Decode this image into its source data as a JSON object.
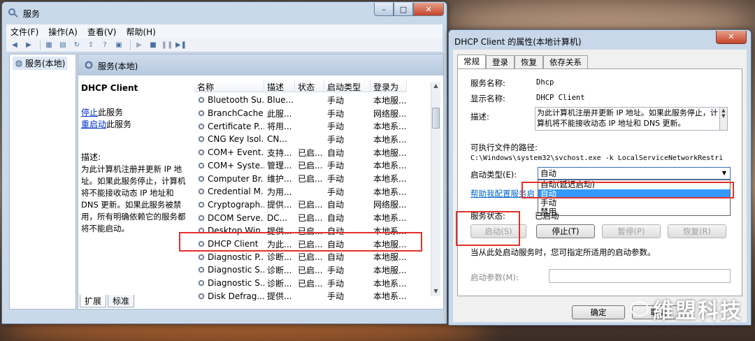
{
  "main_window": {
    "title": "服务",
    "caption": {
      "min": "–",
      "max": "□",
      "close": "✕"
    },
    "menu": [
      "文件(F)",
      "操作(A)",
      "查看(V)",
      "帮助(H)"
    ],
    "tree_root": "服务(本地)",
    "pane_title": "服务(本地)",
    "selected_service": "DHCP Client",
    "link_stop": "停止",
    "link_stop_suffix": "此服务",
    "link_restart": "重启动",
    "link_restart_suffix": "此服务",
    "desc_label": "描述:",
    "description": "为此计算机注册并更新 IP 地址。如果此服务停止，计算机将不能接收动态 IP 地址和 DNS 更新。如果此服务被禁用，所有明确依赖它的服务都将不能启动。",
    "columns": [
      "名称",
      "描述",
      "状态",
      "启动类型",
      "登录为"
    ],
    "rows": [
      [
        "Bluetooth Su...",
        "Blue...",
        "",
        "手动",
        "本地服..."
      ],
      [
        "BranchCache",
        "此服...",
        "",
        "手动",
        "网络服..."
      ],
      [
        "Certificate P...",
        "将用...",
        "",
        "手动",
        "本地系..."
      ],
      [
        "CNG Key Isol...",
        "CN...",
        "",
        "手动",
        "本地系..."
      ],
      [
        "COM+ Event...",
        "支持...",
        "已启...",
        "自动",
        "本地服..."
      ],
      [
        "COM+ Syste...",
        "管理...",
        "已启...",
        "手动",
        "本地系..."
      ],
      [
        "Computer Br...",
        "维护...",
        "已启...",
        "手动",
        "本地系..."
      ],
      [
        "Credential M...",
        "为用...",
        "",
        "手动",
        "本地系..."
      ],
      [
        "Cryptograph...",
        "提供...",
        "已启...",
        "自动",
        "网络服..."
      ],
      [
        "DCOM Serve...",
        "DC...",
        "已启...",
        "自动",
        "本地系..."
      ],
      [
        "Desktop Win...",
        "提供...",
        "已启...",
        "自动",
        "本地系..."
      ],
      [
        "DHCP Client",
        "为此...",
        "已启...",
        "自动",
        "本地服..."
      ],
      [
        "Diagnostic P...",
        "诊断...",
        "已启...",
        "自动",
        "本地服..."
      ],
      [
        "Diagnostic S...",
        "诊断...",
        "已启...",
        "手动",
        "本地服..."
      ],
      [
        "Diagnostic S...",
        "诊断...",
        "已启...",
        "手动",
        "本地系..."
      ],
      [
        "Disk Defrag...",
        "提供...",
        "",
        "手动",
        "本地系..."
      ]
    ],
    "bottom_tabs": [
      "扩展",
      "标准"
    ]
  },
  "dialog": {
    "title": "DHCP Client 的属性(本地计算机)",
    "close": "✕",
    "tabs": [
      "常规",
      "登录",
      "恢复",
      "依存关系"
    ],
    "service_name_label": "服务名称:",
    "service_name": "Dhcp",
    "display_name_label": "显示名称:",
    "display_name": "DHCP Client",
    "desc_label": "描述:",
    "description": "为此计算机注册并更新 IP 地址。如果此服务停止，计算机将不能接收动态 IP 地址和 DNS 更新。",
    "path_label": "可执行文件的路径:",
    "path": "C:\\Windows\\system32\\svchost.exe -k LocalServiceNetworkRestri",
    "startup_type_label": "启动类型(E):",
    "startup_type_value": "自动",
    "startup_options": [
      "自动(延迟启动)",
      "自动",
      "手动",
      "禁用"
    ],
    "help_link": "帮助我配置服务启",
    "status_label": "服务状态:",
    "status_value": "已启动",
    "btn_start": "启动(S)",
    "btn_stop": "停止(T)",
    "btn_pause": "暂停(P)",
    "btn_resume": "恢复(R)",
    "start_note": "当从此处启动服务时，您可指定所适用的启动参数。",
    "params_label": "启动参数(M):",
    "ok": "确定",
    "cancel": "取消"
  },
  "watermark": "維盟科技"
}
